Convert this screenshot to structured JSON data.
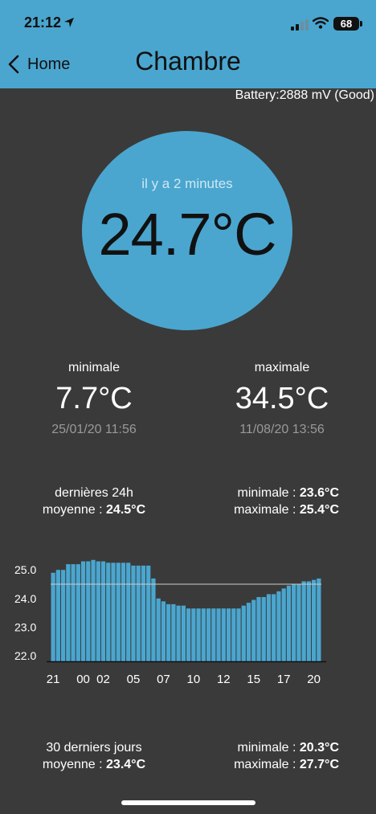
{
  "status": {
    "time": "21:12",
    "battery": "68"
  },
  "nav": {
    "back_label": "Home",
    "title": "Chambre"
  },
  "battery_info": "Battery:2888 mV (Good)",
  "current": {
    "updated": "il y a 2 minutes",
    "temperature": "24.7°C"
  },
  "min": {
    "label": "minimale",
    "value": "7.7°C",
    "date": "25/01/20 11:56"
  },
  "max": {
    "label": "maximale",
    "value": "34.5°C",
    "date": "11/08/20 13:56"
  },
  "last24": {
    "period": "dernières 24h",
    "avg_label": "moyenne :",
    "avg": "24.5°C",
    "min_label": "minimale :",
    "min": "23.6°C",
    "max_label": "maximale :",
    "max": "25.4°C"
  },
  "last30": {
    "period": "30 derniers jours",
    "avg_label": "moyenne :",
    "avg": "23.4°C",
    "min_label": "minimale :",
    "min": "20.3°C",
    "max_label": "maximale :",
    "max": "27.7°C"
  },
  "chart_data": {
    "type": "bar",
    "title": "",
    "xlabel": "",
    "ylabel": "",
    "ylim": [
      21.8,
      25.4
    ],
    "yticks": [
      "25.0",
      "24.0",
      "23.0",
      "22.0"
    ],
    "ytick_values": [
      25.0,
      24.0,
      23.0,
      22.0
    ],
    "xticks": [
      "21",
      "00",
      "02",
      "05",
      "07",
      "10",
      "12",
      "15",
      "17",
      "20"
    ],
    "xtick_index": [
      0,
      6,
      10,
      16,
      22,
      28,
      34,
      40,
      46,
      52
    ],
    "average_line": 24.5,
    "bar_color": "#4aa6cf",
    "values": [
      24.9,
      25.0,
      25.0,
      25.2,
      25.2,
      25.2,
      25.3,
      25.3,
      25.35,
      25.3,
      25.3,
      25.25,
      25.25,
      25.25,
      25.25,
      25.25,
      25.15,
      25.15,
      25.15,
      25.15,
      24.7,
      24.0,
      23.9,
      23.8,
      23.8,
      23.75,
      23.75,
      23.65,
      23.65,
      23.65,
      23.65,
      23.65,
      23.65,
      23.65,
      23.65,
      23.65,
      23.65,
      23.65,
      23.75,
      23.85,
      23.95,
      24.05,
      24.05,
      24.15,
      24.15,
      24.25,
      24.35,
      24.45,
      24.5,
      24.5,
      24.6,
      24.6,
      24.65,
      24.7
    ]
  }
}
